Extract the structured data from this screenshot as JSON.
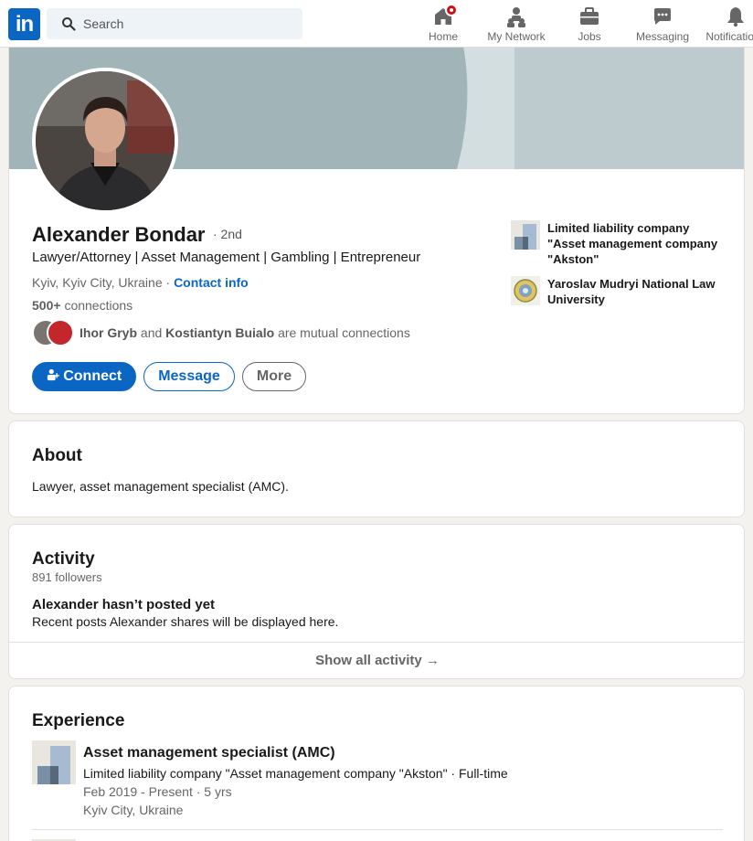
{
  "nav": {
    "logo": "in",
    "search_placeholder": "Search",
    "items": [
      {
        "label": "Home",
        "icon": "home-icon"
      },
      {
        "label": "My Network",
        "icon": "network-icon"
      },
      {
        "label": "Jobs",
        "icon": "briefcase-icon"
      },
      {
        "label": "Messaging",
        "icon": "messaging-icon"
      },
      {
        "label": "Notifications",
        "icon": "bell-icon"
      }
    ]
  },
  "profile": {
    "name": "Alexander Bondar",
    "degree": "· 2nd",
    "headline": "Lawyer/Attorney | Asset Management | Gambling | Entrepreneur",
    "location": "Kyiv, Kyiv City, Ukraine ·",
    "contact_info": "Contact info",
    "connections_count": "500+",
    "connections_label": "connections",
    "mutual": {
      "person1": "Ihor Gryb",
      "and": "and",
      "person2": "Kostiantyn Buialo",
      "suffix": "are mutual connections"
    },
    "buttons": {
      "connect": "Connect",
      "message": "Message",
      "more": "More"
    },
    "side": [
      {
        "name": "Limited liability company \"Asset management company \"Akston\"",
        "logo": "company-logo"
      },
      {
        "name": "Yaroslav Mudryi National Law University",
        "logo": "university-logo"
      }
    ]
  },
  "about": {
    "title": "About",
    "text": "Lawyer, asset management specialist (AMC)."
  },
  "activity": {
    "title": "Activity",
    "followers": "891 followers",
    "empty_title": "Alexander hasn’t posted yet",
    "empty_text": "Recent posts Alexander shares will be displayed here.",
    "show_all": "Show all activity →"
  },
  "experience": {
    "title": "Experience",
    "items": [
      {
        "role": "Asset management specialist (AMC)",
        "company": "Limited liability company \"Asset management company \"Akston\" · Full-time",
        "dates": "Feb 2019 - Present · 5 yrs",
        "location": "Kyiv City, Ukraine"
      }
    ]
  },
  "colors": {
    "brand": "#0a66c2",
    "notification_badge": "#cc1016",
    "banner": "#a0b4b7"
  }
}
